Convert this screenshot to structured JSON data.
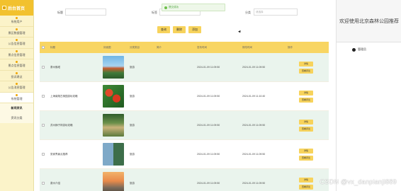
{
  "sidebar": {
    "brand": "后台首页",
    "items": [
      {
        "label": "系统用户"
      },
      {
        "label": "景区数据管理"
      },
      {
        "label": "公告信息管理"
      },
      {
        "label": "景点信息管理"
      },
      {
        "label": "景点信息管理"
      },
      {
        "label": "投诉建议"
      },
      {
        "label": "公告消息管理"
      },
      {
        "label": "系统管理"
      }
    ],
    "sub_items": [
      {
        "label": "新闻资讯"
      },
      {
        "label": "资讯分类"
      }
    ]
  },
  "search": {
    "title_label": "标题",
    "tag_label": "标签",
    "category_label": "分类",
    "category_placeholder": "请选择"
  },
  "toast": {
    "text": "提交成功"
  },
  "actions": {
    "search": "查询",
    "delete": "删除",
    "add": "添加"
  },
  "table": {
    "headers": [
      "标题",
      "封面图",
      "分类类目",
      "简介",
      "发布时间",
      "修改时间",
      "操作"
    ],
    "row_buttons": {
      "detail": "详情",
      "comment": "查看评论"
    },
    "rows": [
      {
        "title": "泰州佛塔",
        "category": "旅游",
        "intro": "",
        "published": "2024-01-09 11:09:50",
        "modified": "2024-01-09 11:09:50",
        "img": "pagoda"
      },
      {
        "title": "上海南翔古猗园游玩攻略",
        "category": "旅游",
        "intro": "",
        "published": "2024-01-09 11:09:50",
        "modified": "2024-01-09 11:10:40",
        "img": "fruit"
      },
      {
        "title": "苏州狮子林游玩攻略",
        "category": "旅游",
        "intro": "",
        "published": "2024-01-09 11:09:50",
        "modified": "2024-01-09 11:09:50",
        "img": "garden"
      },
      {
        "title": "张家界景点推荐",
        "category": "旅游",
        "intro": "",
        "published": "2024-01-09 11:09:50",
        "modified": "2024-01-09 11:09:50",
        "img": "collage"
      },
      {
        "title": "泉州介绍",
        "category": "旅游",
        "intro": "",
        "published": "2024-01-09 11:09:50",
        "modified": "2024-01-09 11:09:50",
        "img": "sunset"
      }
    ]
  },
  "right": {
    "welcome": "欢迎使用北京森林公园推荐",
    "user": "管理员"
  },
  "watermark": "CSDN @vx_danpianji889",
  "colors": {
    "accent": "#f7d35c",
    "sidebar": "#fbf3c9",
    "row_alt": "#eaf4ed",
    "brand": "#f2c12e"
  }
}
